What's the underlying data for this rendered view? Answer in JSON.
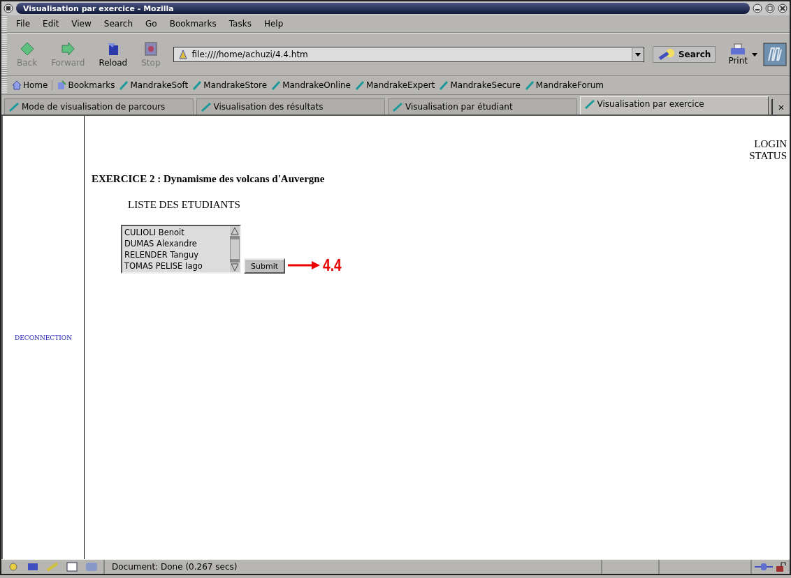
{
  "window": {
    "title": "Visualisation par exercice - Mozilla"
  },
  "menu": [
    "File",
    "Edit",
    "View",
    "Search",
    "Go",
    "Bookmarks",
    "Tasks",
    "Help"
  ],
  "nav_buttons": [
    {
      "kind": "back",
      "label": "Back",
      "disabled": true
    },
    {
      "kind": "forward",
      "label": "Forward",
      "disabled": true
    },
    {
      "kind": "reload",
      "label": "Reload",
      "disabled": false
    },
    {
      "kind": "stop",
      "label": "Stop",
      "disabled": true
    }
  ],
  "url": "file:////home/achuzi/4.4.htm",
  "search_button": "Search",
  "print_button": "Print",
  "bookmarks": [
    {
      "kind": "home",
      "label": "Home"
    },
    {
      "kind": "folder",
      "label": "Bookmarks"
    },
    {
      "kind": "link",
      "label": "MandrakeSoft"
    },
    {
      "kind": "link",
      "label": "MandrakeStore"
    },
    {
      "kind": "link",
      "label": "MandrakeOnline"
    },
    {
      "kind": "link",
      "label": "MandrakeExpert"
    },
    {
      "kind": "link",
      "label": "MandrakeSecure"
    },
    {
      "kind": "link",
      "label": "MandrakeForum"
    }
  ],
  "tabs": [
    {
      "label": "Mode de visualisation de parcours",
      "selected": false
    },
    {
      "label": "Visualisation des résultats",
      "selected": false
    },
    {
      "label": "Visualisation par étudiant",
      "selected": false
    },
    {
      "label": "Visualisation par exercice",
      "selected": true
    }
  ],
  "tab_close": "×",
  "page": {
    "deconnection_link": "DECONNECTION",
    "login_status": [
      "LOGIN",
      "STATUS"
    ],
    "heading": "EXERCICE 2 : Dynamisme des volcans d'Auvergne",
    "list_label": "LISTE DES ETUDIANTS",
    "students": [
      "CULIOLI Benoit",
      "DUMAS Alexandre",
      "RELENDER Tanguy",
      "TOMAS PELISE Iago"
    ],
    "submit_button": "Submit",
    "annotation": "4.4"
  },
  "status_bar": {
    "text": "Document: Done (0.267 secs)"
  }
}
